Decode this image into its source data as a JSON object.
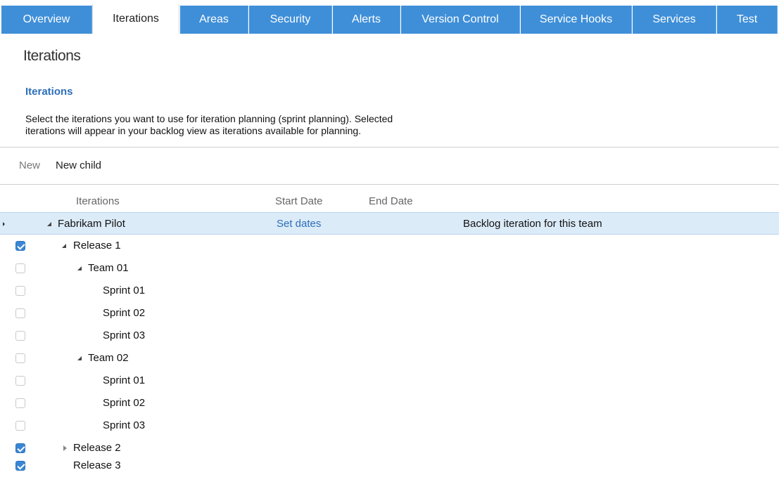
{
  "tabs": [
    {
      "label": "Overview"
    },
    {
      "label": "Iterations"
    },
    {
      "label": "Areas"
    },
    {
      "label": "Security"
    },
    {
      "label": "Alerts"
    },
    {
      "label": "Version Control"
    },
    {
      "label": "Service Hooks"
    },
    {
      "label": "Services"
    },
    {
      "label": "Test"
    }
  ],
  "active_tab": "Iterations",
  "page_title": "Iterations",
  "section_title": "Iterations",
  "description": {
    "line1": "Select the iterations you want to use for iteration planning (sprint planning). Selected",
    "line2": "iterations will appear in your backlog view as iterations available for planning."
  },
  "toolbar": {
    "new_label": "New",
    "new_child_label": "New child"
  },
  "columns": {
    "iterations": "Iterations",
    "start_date": "Start Date",
    "end_date": "End Date"
  },
  "rows": [
    {
      "label": "Fabrikam Pilot",
      "checked": null,
      "expander": "expanded",
      "set_dates": "Set dates",
      "note": "Backlog iteration for this team"
    },
    {
      "label": "Release 1",
      "checked": true,
      "expander": "expanded"
    },
    {
      "label": "Team 01",
      "checked": false,
      "expander": "expanded"
    },
    {
      "label": "Sprint 01",
      "checked": false,
      "expander": "none"
    },
    {
      "label": "Sprint 02",
      "checked": false,
      "expander": "none"
    },
    {
      "label": "Sprint 03",
      "checked": false,
      "expander": "none"
    },
    {
      "label": "Team 02",
      "checked": false,
      "expander": "expanded"
    },
    {
      "label": "Sprint 01",
      "checked": false,
      "expander": "none"
    },
    {
      "label": "Sprint 02",
      "checked": false,
      "expander": "none"
    },
    {
      "label": "Sprint 03",
      "checked": false,
      "expander": "none"
    },
    {
      "label": "Release 2",
      "checked": true,
      "expander": "collapsed"
    },
    {
      "label": "Release 3",
      "checked": true,
      "expander": "none"
    }
  ],
  "colors": {
    "tab_blue": "#3f8fd8",
    "link_blue": "#2d6fb8",
    "highlight": "#dcebf8",
    "checkbox_blue": "#3a86d4"
  }
}
